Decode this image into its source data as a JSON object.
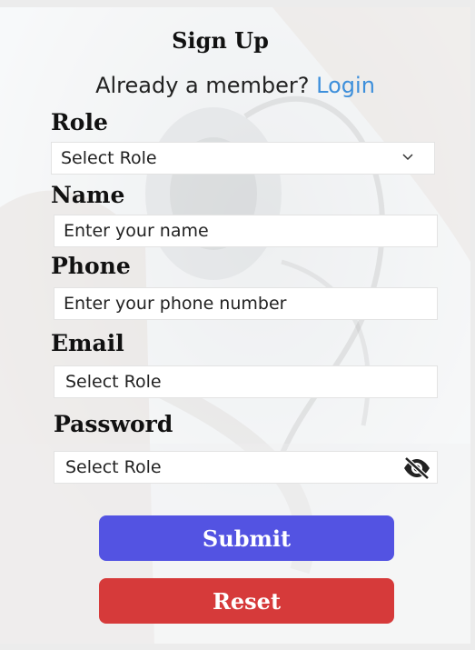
{
  "form": {
    "title": "Sign Up",
    "member_prompt": "Already a member?",
    "login_link": "Login"
  },
  "fields": {
    "role": {
      "label": "Role",
      "value": "Select Role"
    },
    "name": {
      "label": "Name",
      "placeholder": "Enter your name"
    },
    "phone": {
      "label": "Phone",
      "placeholder": "Enter your phone number"
    },
    "email": {
      "label": "Email",
      "value": "Select Role"
    },
    "password": {
      "label": "Password",
      "value": "Select Role"
    }
  },
  "buttons": {
    "submit": "Submit",
    "reset": "Reset"
  },
  "colors": {
    "submit": "#5353e2",
    "reset": "#d63a3a",
    "link": "#3d8fdb"
  },
  "icons": {
    "role_dropdown": "chevron-down-icon",
    "password_toggle": "eye-slash-icon"
  }
}
